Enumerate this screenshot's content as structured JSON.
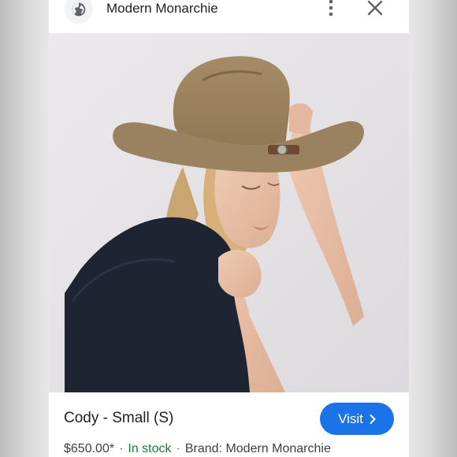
{
  "header": {
    "site_name": "Modern Monarchie",
    "globe_icon": "globe-icon",
    "menu_icon": "more-vert-icon",
    "close_icon": "close-icon"
  },
  "image": {
    "alt_subject": "woman wearing tan felt cowboy hat"
  },
  "product": {
    "title": "Cody - Small (S)",
    "price": "$650.00*",
    "stock": "In stock",
    "brand": "Brand: Modern Monarchie",
    "separator": "·"
  },
  "actions": {
    "visit_label": "Visit",
    "visit_icon": "chevron-right-icon"
  },
  "colors": {
    "accent": "#1a73e8",
    "stock_green": "#188038",
    "text_primary": "#202124"
  }
}
